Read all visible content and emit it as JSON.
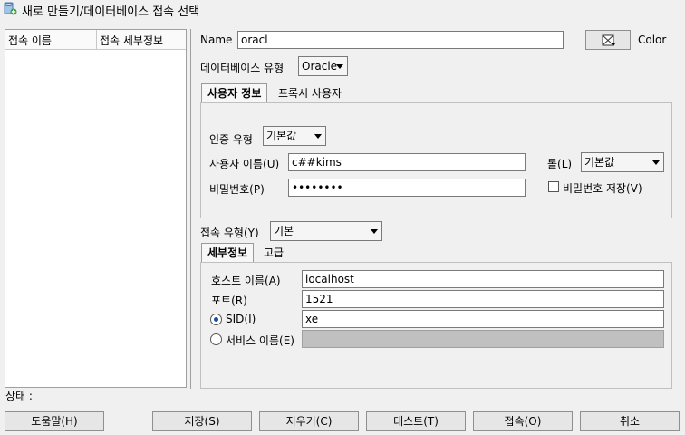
{
  "window": {
    "title": "새로 만들기/데이터베이스 접속 선택"
  },
  "connection_list": {
    "columns": [
      "접속 이름",
      "접속 세부정보"
    ]
  },
  "name": {
    "label": "Name",
    "value": "oracl"
  },
  "color": {
    "label": "Color"
  },
  "db_type": {
    "label": "데이터베이스 유형",
    "value": "Oracle"
  },
  "user_tabs": [
    "사용자 정보",
    "프록시 사용자"
  ],
  "auth": {
    "auth_type_label": "인증 유형",
    "auth_type_value": "기본값",
    "username_label": "사용자 이름(U)",
    "username_value": "c##kims",
    "role_label": "롤(L)",
    "role_value": "기본값",
    "password_label": "비밀번호(P)",
    "password_value": "••••••••",
    "save_password_label": "비밀번호 저장(V)"
  },
  "connection_type": {
    "label": "접속 유형(Y)",
    "value": "기본"
  },
  "detail_tabs": [
    "세부정보",
    "고급"
  ],
  "details": {
    "host_label": "호스트 이름(A)",
    "host_value": "localhost",
    "port_label": "포트(R)",
    "port_value": "1521",
    "sid_label": "SID(I)",
    "sid_value": "xe",
    "service_label": "서비스 이름(E)",
    "service_value": ""
  },
  "status": {
    "label": "상태 :"
  },
  "buttons": {
    "help": "도움말(H)",
    "save": "저장(S)",
    "clear": "지우기(C)",
    "test": "테스트(T)",
    "connect": "접속(O)",
    "cancel": "취소"
  }
}
